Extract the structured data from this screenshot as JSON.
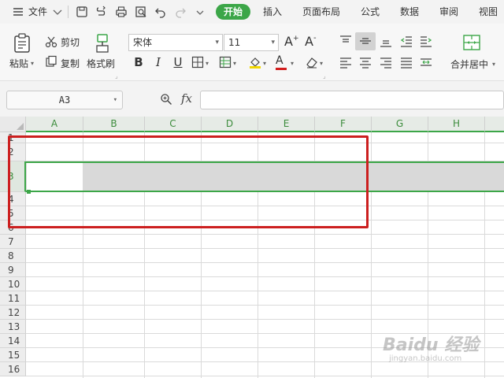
{
  "menu": {
    "file_label": "文件",
    "tabs": [
      "开始",
      "插入",
      "页面布局",
      "公式",
      "数据",
      "审阅",
      "视图"
    ],
    "active_tab": "开始"
  },
  "ribbon": {
    "paste": "粘贴",
    "cut": "剪切",
    "copy": "复制",
    "format_painter": "格式刷",
    "font_name": "宋体",
    "font_size": "11",
    "merge_center": "合并居中",
    "increase_font": "A",
    "decrease_font": "A",
    "bold": "B",
    "italic": "I",
    "underline": "U",
    "font_color_letter": "A"
  },
  "formula_bar": {
    "name_box": "A3",
    "fx": "fx",
    "formula": ""
  },
  "sheet": {
    "columns": [
      "A",
      "B",
      "C",
      "D",
      "E",
      "F",
      "G",
      "H"
    ],
    "rows": [
      "1",
      "2",
      "3",
      "4",
      "5",
      "6",
      "7",
      "8",
      "9",
      "10",
      "11",
      "12",
      "13",
      "14",
      "15",
      "16"
    ],
    "selected_row": "3",
    "active_cell": "A3"
  },
  "watermark": {
    "main": "Baidu 经验",
    "sub": "jingyan.baidu.com"
  },
  "colors": {
    "accent": "#3ca648",
    "annotation_red": "#cc1f1f",
    "selection_gray": "#d9d9d9"
  }
}
